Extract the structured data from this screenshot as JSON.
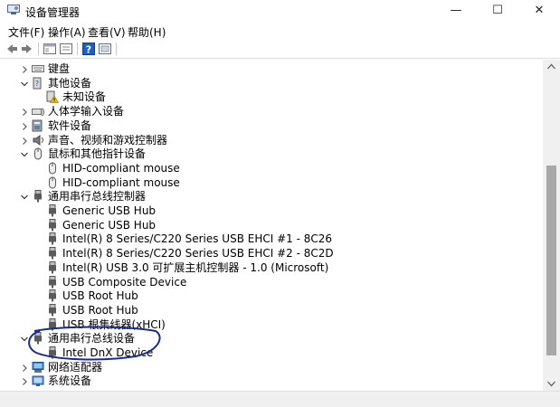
{
  "window": {
    "title": "设备管理器",
    "minimize": "—",
    "maximize": "☐",
    "close": "✕"
  },
  "menu": [
    "文件(F)",
    "操作(A)",
    "查看(V)",
    "帮助(H)"
  ],
  "tree": [
    {
      "level": 1,
      "state": "collapsed",
      "icon": "keyboard-icon",
      "label": "键盘"
    },
    {
      "level": 1,
      "state": "expanded",
      "icon": "other-devices-icon",
      "label": "其他设备"
    },
    {
      "level": 2,
      "state": "none",
      "icon": "unknown-device-warning-icon",
      "label": "未知设备"
    },
    {
      "level": 1,
      "state": "collapsed",
      "icon": "hid-icon",
      "label": "人体学输入设备"
    },
    {
      "level": 1,
      "state": "collapsed",
      "icon": "software-device-icon",
      "label": "软件设备"
    },
    {
      "level": 1,
      "state": "collapsed",
      "icon": "speaker-icon",
      "label": "声音、视频和游戏控制器"
    },
    {
      "level": 1,
      "state": "expanded",
      "icon": "mouse-icon",
      "label": "鼠标和其他指针设备"
    },
    {
      "level": 2,
      "state": "none",
      "icon": "mouse-icon",
      "label": "HID-compliant mouse"
    },
    {
      "level": 2,
      "state": "none",
      "icon": "mouse-icon",
      "label": "HID-compliant mouse"
    },
    {
      "level": 1,
      "state": "expanded",
      "icon": "usb-icon",
      "label": "通用串行总线控制器"
    },
    {
      "level": 2,
      "state": "none",
      "icon": "usb-icon",
      "label": "Generic USB Hub"
    },
    {
      "level": 2,
      "state": "none",
      "icon": "usb-icon",
      "label": "Generic USB Hub"
    },
    {
      "level": 2,
      "state": "none",
      "icon": "usb-icon",
      "label": "Intel(R) 8 Series/C220 Series USB EHCI #1 - 8C26"
    },
    {
      "level": 2,
      "state": "none",
      "icon": "usb-icon",
      "label": "Intel(R) 8 Series/C220 Series USB EHCI #2 - 8C2D"
    },
    {
      "level": 2,
      "state": "none",
      "icon": "usb-icon",
      "label": "Intel(R) USB 3.0 可扩展主机控制器 - 1.0 (Microsoft)"
    },
    {
      "level": 2,
      "state": "none",
      "icon": "usb-icon",
      "label": "USB Composite Device"
    },
    {
      "level": 2,
      "state": "none",
      "icon": "usb-icon",
      "label": "USB Root Hub"
    },
    {
      "level": 2,
      "state": "none",
      "icon": "usb-icon",
      "label": "USB Root Hub"
    },
    {
      "level": 2,
      "state": "none",
      "icon": "usb-icon",
      "label": "USB 根集线器(xHCI)"
    },
    {
      "level": 1,
      "state": "expanded",
      "icon": "usb-icon",
      "label": "通用串行总线设备"
    },
    {
      "level": 2,
      "state": "none",
      "icon": "usb-icon",
      "label": "Intel DnX Device"
    },
    {
      "level": 1,
      "state": "collapsed",
      "icon": "network-adapter-icon",
      "label": "网络适配器"
    },
    {
      "level": 1,
      "state": "collapsed",
      "icon": "system-device-icon",
      "label": "系统设备"
    }
  ]
}
